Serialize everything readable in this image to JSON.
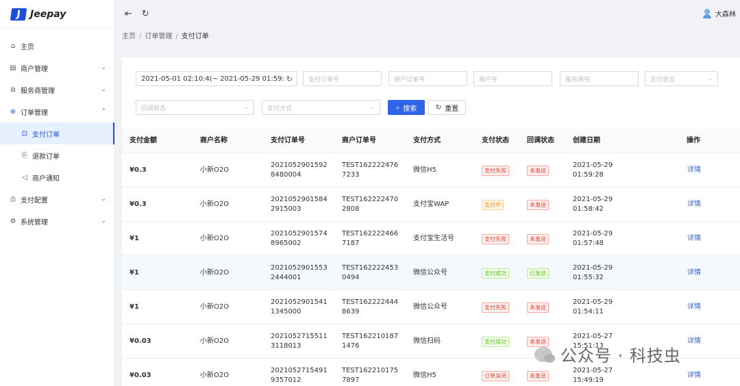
{
  "app": {
    "logo_text": "Jeepay",
    "logo_mark": "J"
  },
  "sidebar": {
    "items": [
      {
        "label": "主页",
        "icon": "home-icon"
      },
      {
        "label": "商户管理",
        "icon": "merchant-icon"
      },
      {
        "label": "服务商管理",
        "icon": "provider-icon"
      },
      {
        "label": "订单管理",
        "icon": "order-icon"
      },
      {
        "label": "支付订单",
        "icon": "pay-order-icon"
      },
      {
        "label": "退款订单",
        "icon": "refund-icon"
      },
      {
        "label": "商户通知",
        "icon": "notify-icon"
      },
      {
        "label": "支付配置",
        "icon": "pay-config-icon"
      },
      {
        "label": "系统管理",
        "icon": "system-icon"
      }
    ]
  },
  "header": {
    "user_name": "大森林"
  },
  "breadcrumb": {
    "home": "主页",
    "parent": "订单管理",
    "current": "支付订单"
  },
  "filters": {
    "date_range": "2021-05-01 02:10:4(~ 2021-05-29 01:59:5!",
    "pay_order_no": "支付订单号",
    "mch_order_no": "商户订单号",
    "mch_no": "商户号",
    "isv_no": "服务商号",
    "pay_state": "支付状态",
    "notify_state": "回调状态",
    "pay_way": "支付方式",
    "search_label": "搜索",
    "reset_label": "重置"
  },
  "table": {
    "columns": [
      "支付金额",
      "商户名称",
      "支付订单号",
      "商户订单号",
      "支付方式",
      "支付状态",
      "回调状态",
      "创建日期",
      "操作"
    ],
    "rows": [
      {
        "amount": "¥0.3",
        "mch_name": "小新O2O",
        "pay_order_no": "20210529015928480004",
        "mch_order_no": "TEST1622224767233",
        "pay_way": "微信H5",
        "pay_state": "支付失败",
        "notify_state": "未发送",
        "created_date": "2021-05-29",
        "created_time": "01:59:28",
        "action": "详情"
      },
      {
        "amount": "¥0.3",
        "mch_name": "小新O2O",
        "pay_order_no": "20210529015842915003",
        "mch_order_no": "TEST1622224702808",
        "pay_way": "支付宝WAP",
        "pay_state": "支付中",
        "notify_state": "未发送",
        "created_date": "2021-05-29",
        "created_time": "01:58:42",
        "action": "详情"
      },
      {
        "amount": "¥1",
        "mch_name": "小新O2O",
        "pay_order_no": "20210529015748965002",
        "mch_order_no": "TEST1622224667187",
        "pay_way": "支付宝生活号",
        "pay_state": "支付失败",
        "notify_state": "未发送",
        "created_date": "2021-05-29",
        "created_time": "01:57:48",
        "action": "详情"
      },
      {
        "amount": "¥1",
        "mch_name": "小新O2O",
        "pay_order_no": "20210529015532444001",
        "mch_order_no": "TEST1622224530494",
        "pay_way": "微信公众号",
        "pay_state": "支付成功",
        "notify_state": "已发送",
        "created_date": "2021-05-29",
        "created_time": "01:55:32",
        "action": "详情"
      },
      {
        "amount": "¥1",
        "mch_name": "小新O2O",
        "pay_order_no": "20210529015411345000",
        "mch_order_no": "TEST1622224448639",
        "pay_way": "微信公众号",
        "pay_state": "支付失败",
        "notify_state": "未发送",
        "created_date": "2021-05-29",
        "created_time": "01:54:11",
        "action": "详情"
      },
      {
        "amount": "¥0.03",
        "mch_name": "小新O2O",
        "pay_order_no": "20210527155113118013",
        "mch_order_no": "TEST1622101871476",
        "pay_way": "微信扫码",
        "pay_state": "支付成功",
        "notify_state": "未发送",
        "created_date": "2021-05-27",
        "created_time": "15:51:13",
        "action": "详情"
      },
      {
        "amount": "¥0.03",
        "mch_name": "小新O2O",
        "pay_order_no": "20210527154919357012",
        "mch_order_no": "TEST1622101757897",
        "pay_way": "微信H5",
        "pay_state": "订单关闭",
        "notify_state": "未发送",
        "created_date": "2021-05-27",
        "created_time": "15:49:19",
        "action": "详情"
      }
    ]
  },
  "watermark": {
    "text": "公众号 · 科技虫"
  },
  "colors": {
    "accent": "#2d64e8",
    "fail": "#e0432f",
    "pending": "#fa8c16",
    "success": "#52c41a"
  }
}
